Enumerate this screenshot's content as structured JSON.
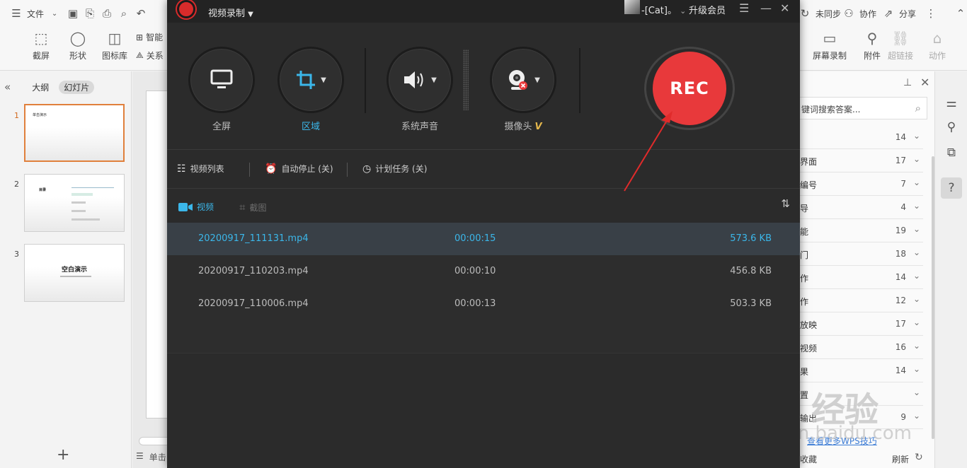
{
  "wps": {
    "toolbar": {
      "file_menu": "文件",
      "not_synced": "未同步",
      "collaborate": "协作",
      "share": "分享",
      "ribbon": {
        "screenshot": "截屏",
        "shape": "形状",
        "icon_lib": "图标库",
        "smart": "智能",
        "relation": "关系",
        "screen_record": "屏幕录制",
        "attachment": "附件",
        "hyperlink": "超链接",
        "action": "动作"
      }
    },
    "left_panel": {
      "tab_outline": "大纲",
      "tab_slides": "幻灯片",
      "slides": [
        {
          "num": "1",
          "title": "单击演示"
        },
        {
          "num": "2",
          "title": "目录"
        },
        {
          "num": "3",
          "title": "空白演示"
        }
      ],
      "add_slide": "+"
    },
    "status": {
      "left_text": "单击"
    },
    "right_panel": {
      "search_placeholder": "键词搜索答案...",
      "items": [
        {
          "label": "",
          "count": "14"
        },
        {
          "label": "界面",
          "count": "17"
        },
        {
          "label": "编号",
          "count": "7"
        },
        {
          "label": "导",
          "count": "4"
        },
        {
          "label": "能",
          "count": "19"
        },
        {
          "label": "门",
          "count": "18"
        },
        {
          "label": "作",
          "count": "14"
        },
        {
          "label": "作",
          "count": "12"
        },
        {
          "label": "放映",
          "count": "17"
        },
        {
          "label": "视频",
          "count": "16"
        },
        {
          "label": "果",
          "count": "14"
        },
        {
          "label": "置",
          "count": ""
        },
        {
          "label": "输出",
          "count": "9"
        }
      ],
      "more_link": "查看更多WPS技巧",
      "collect": "收藏",
      "refresh": "刷新"
    },
    "watermark": {
      "brand": "Bai  经验",
      "url": "jingyan.baidu.com"
    }
  },
  "recorder": {
    "title": "视频录制",
    "user": "-[Cat]。",
    "upgrade": "升级会员",
    "controls": {
      "fullscreen": "全屏",
      "region": "区域",
      "system_audio": "系统声音",
      "camera": "摄像头",
      "camera_badge": "V"
    },
    "rec_button": "REC",
    "subbar": {
      "video_list": "视频列表",
      "auto_stop": "自动停止 (关)",
      "schedule": "计划任务 (关)"
    },
    "tabs": {
      "video": "视频",
      "screenshot": "截图"
    },
    "files": [
      {
        "name": "20200917_111131.mp4",
        "duration": "00:00:15",
        "size": "573.6 KB",
        "selected": true
      },
      {
        "name": "20200917_110203.mp4",
        "duration": "00:00:10",
        "size": "456.8 KB",
        "selected": false
      },
      {
        "name": "20200917_110006.mp4",
        "duration": "00:00:13",
        "size": "503.3 KB",
        "selected": false
      }
    ],
    "colors": {
      "accent": "#3bb7ea",
      "rec": "#e8393b",
      "arrow": "#e02b2b"
    }
  }
}
